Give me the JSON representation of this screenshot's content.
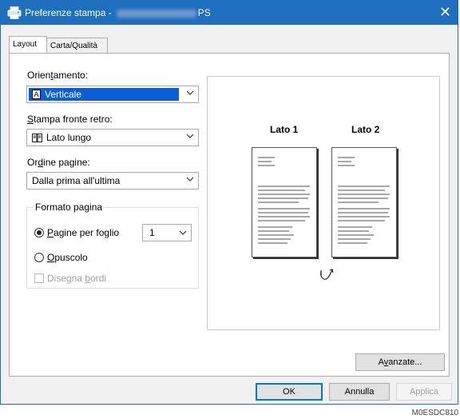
{
  "window": {
    "title_prefix": "Preferenze stampa -",
    "title_suffix": "PS",
    "close_glyph": "✕"
  },
  "tabs": [
    {
      "label": "Layout"
    },
    {
      "label": "Carta/Qualità"
    }
  ],
  "orientation": {
    "label_pre": "Orien",
    "label_u": "t",
    "label_post": "amento:",
    "value": "Verticale",
    "icon_glyph": "A"
  },
  "duplex": {
    "label_u": "S",
    "label_post": "tampa fronte retro:",
    "value": "Lato lungo",
    "icon": "book-long-edge-icon"
  },
  "page_order": {
    "label_pre": "Or",
    "label_u": "d",
    "label_post": "ine pagine:",
    "value": "Dalla prima all'ultima"
  },
  "page_format": {
    "legend": "Formato pagina",
    "pages_per_sheet_u": "P",
    "pages_per_sheet_post": "agine per foglio",
    "pages_per_sheet_value": "1",
    "booklet_u": "O",
    "booklet_post": "puscolo",
    "draw_borders_pre": "Disegna ",
    "draw_borders_u": "b",
    "draw_borders_post": "ordi"
  },
  "preview": {
    "side1": "Lato 1",
    "side2": "Lato 2"
  },
  "buttons": {
    "advanced_pre": "A",
    "advanced_u": "v",
    "advanced_post": "anzate...",
    "ok": "OK",
    "cancel": "Annulla",
    "apply": "Applica"
  },
  "figure_code": "M0ESDC810",
  "colors": {
    "titlebar": "#1e6fbe",
    "selection": "#0a5ed8"
  }
}
